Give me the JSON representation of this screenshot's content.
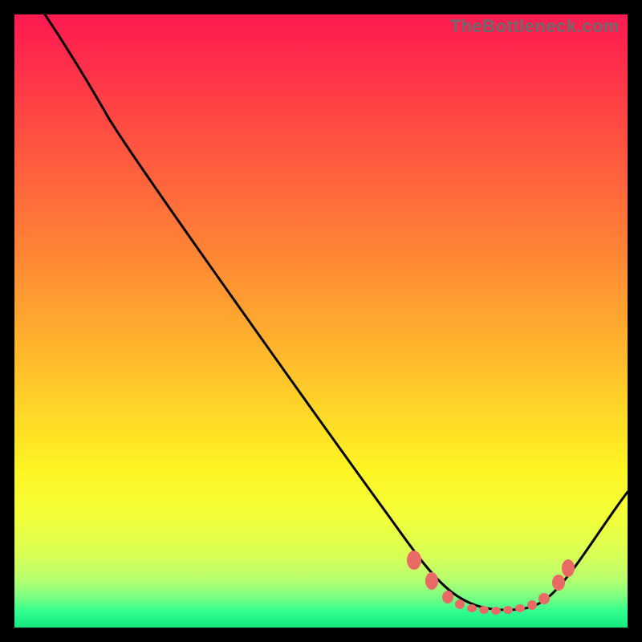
{
  "watermark": "TheBottleneck.com",
  "colors": {
    "frame": "#000000",
    "curve": "#000000",
    "marker": "#e96a65",
    "gradient_top": "#ff1a52",
    "gradient_bottom": "#16e77f"
  },
  "chart_data": {
    "type": "line",
    "title": "",
    "xlabel": "",
    "ylabel": "",
    "xlim": [
      0,
      100
    ],
    "ylim": [
      0,
      100
    ],
    "x": [
      5,
      10,
      15,
      20,
      25,
      30,
      35,
      40,
      45,
      50,
      55,
      60,
      65,
      68,
      70,
      72,
      74,
      76,
      78,
      80,
      82,
      84,
      86,
      90,
      95,
      100
    ],
    "values": [
      100,
      96,
      90,
      83,
      76,
      69,
      62,
      55,
      48,
      41,
      34,
      27,
      19,
      12,
      8,
      6,
      5,
      4,
      3.5,
      3,
      3,
      3.5,
      4,
      7,
      13,
      22
    ],
    "markers": {
      "x": [
        65,
        68,
        70,
        72,
        74,
        76,
        78,
        80,
        82,
        84,
        86,
        87
      ],
      "y": [
        9,
        6,
        4.5,
        4,
        3.5,
        3,
        3,
        3,
        3,
        3.5,
        5,
        9
      ]
    },
    "note": "Axis values estimated from unlabeled gradient chart; 0 = bottom/left, 100 = top/right."
  }
}
